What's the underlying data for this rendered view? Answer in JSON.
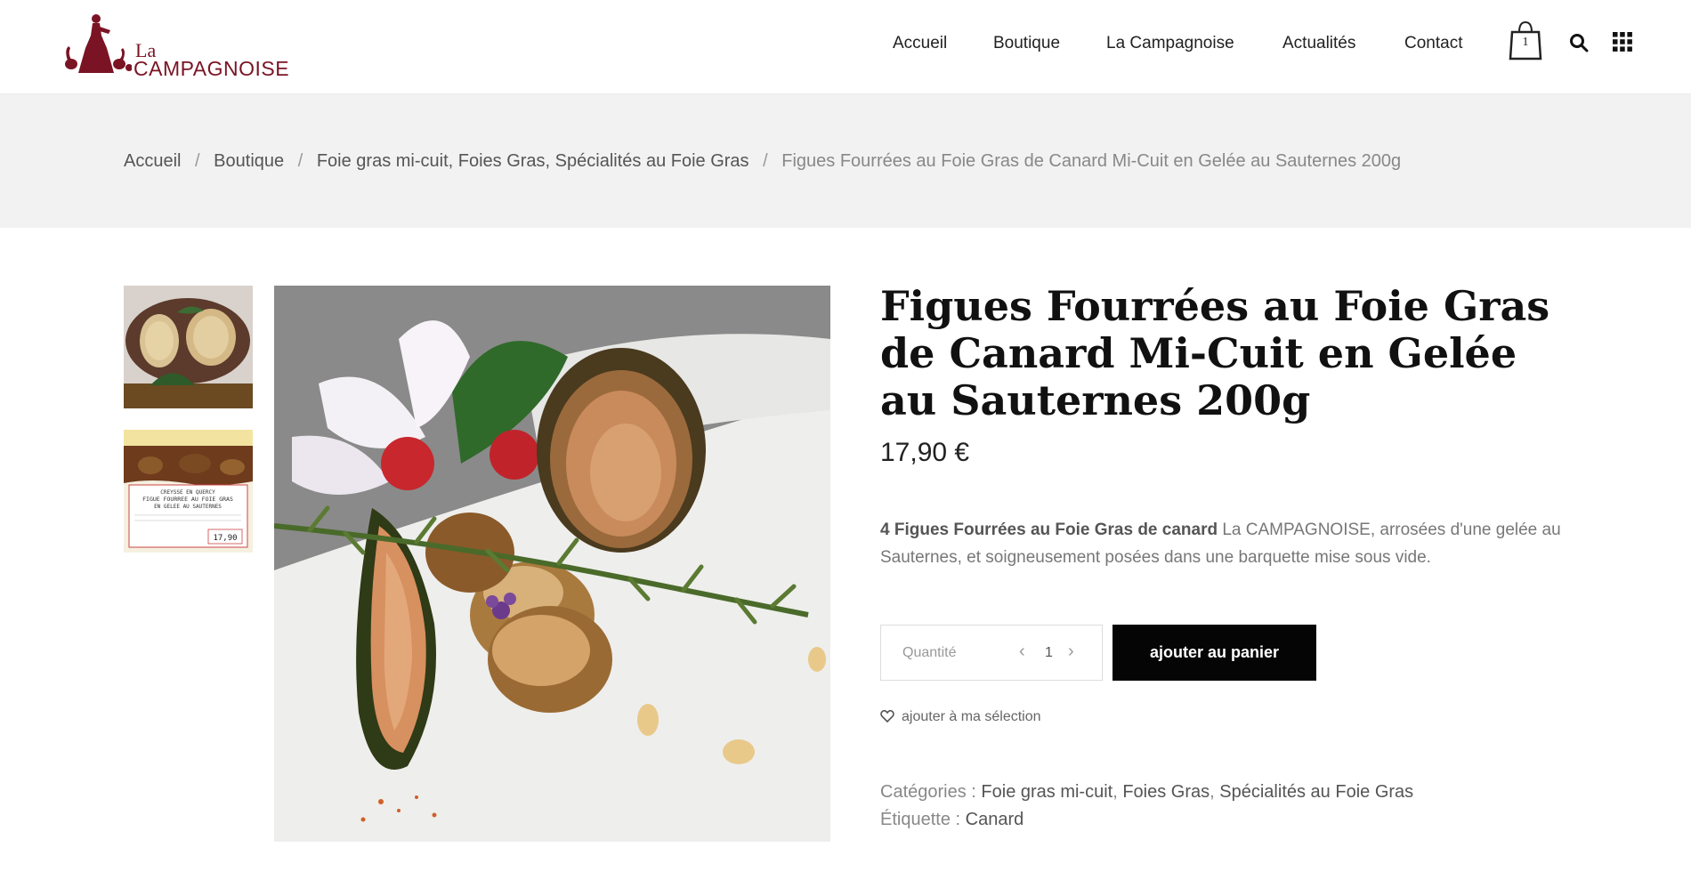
{
  "brand": {
    "logo_small": "La",
    "logo_name": "CAMPAGNOISE"
  },
  "nav": {
    "items": [
      "Accueil",
      "Boutique",
      "La Campagnoise",
      "Actualités",
      "Contact"
    ],
    "cart_count": "1",
    "icons": [
      "shopping-bag-icon",
      "search-icon",
      "grid-menu-icon"
    ]
  },
  "breadcrumb": {
    "items": [
      "Accueil",
      "Boutique",
      "Foie gras mi-cuit, Foies Gras, Spécialités au Foie Gras"
    ],
    "current": "Figues Fourrées au Foie Gras de Canard Mi-Cuit en Gelée au Sauternes 200g",
    "separator": "/"
  },
  "product": {
    "title": "Figues Fourrées au Foie Gras de Canard Mi-Cuit en Gelée au Sauternes 200g",
    "price": "17,90 €",
    "description_bold": "4 Figues Fourrées au Foie Gras de canard",
    "description_rest": " La CAMPAGNOISE, arrosées d'une gelée au Sauternes, et soigneusement posées dans une barquette mise sous vide.",
    "thumb2_label_lines": [
      "CREYSSE EN QUERCY",
      "FIGUE FOURREE AU FOIE GRAS",
      "EN GELEE AU SAUTERNES"
    ],
    "thumb2_price": "17,90"
  },
  "purchase": {
    "qty_label": "Quantité",
    "qty_value": "1",
    "add_to_cart": "ajouter au panier",
    "wishlist": "ajouter à ma sélection"
  },
  "meta": {
    "categories_label": "Catégories :",
    "categories": [
      "Foie gras mi-cuit",
      "Foies Gras",
      "Spécialités au Foie Gras"
    ],
    "tag_label": "Étiquette :",
    "tag": "Canard"
  },
  "colors": {
    "brand": "#7a1424",
    "button": "#050505",
    "band": "#f2f2f2"
  }
}
